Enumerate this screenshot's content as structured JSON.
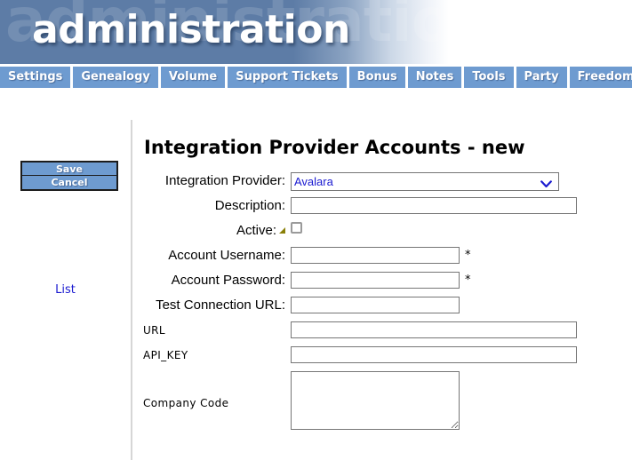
{
  "banner": {
    "title": "administration",
    "watermark": "administration"
  },
  "nav": {
    "items": [
      {
        "label": "Settings"
      },
      {
        "label": "Genealogy"
      },
      {
        "label": "Volume"
      },
      {
        "label": "Support Tickets"
      },
      {
        "label": "Bonus"
      },
      {
        "label": "Notes"
      },
      {
        "label": "Tools"
      },
      {
        "label": "Party"
      },
      {
        "label": "Freedom Bank"
      }
    ]
  },
  "sidebar": {
    "save_label": "Save",
    "cancel_label": "Cancel",
    "list_label": "List"
  },
  "main": {
    "page_title": "Integration Provider Accounts - new",
    "fields": {
      "integration_provider": {
        "label": "Integration Provider:",
        "value": "Avalara",
        "options": [
          "Avalara"
        ]
      },
      "description": {
        "label": "Description:",
        "value": "",
        "placeholder": ""
      },
      "active": {
        "label": "Active:",
        "checked": false,
        "help_icon": "help-triangle-icon"
      },
      "account_username": {
        "label": "Account Username:",
        "value": "",
        "placeholder": "",
        "required_marker": "*"
      },
      "account_password": {
        "label": "Account Password:",
        "value": "",
        "placeholder": "",
        "required_marker": "*"
      },
      "test_connection_url": {
        "label": "Test Connection URL:",
        "value": "",
        "placeholder": ""
      },
      "url": {
        "label": "URL",
        "value": "",
        "placeholder": ""
      },
      "api_key": {
        "label": "API_KEY",
        "value": "",
        "placeholder": ""
      },
      "company_code": {
        "label": "Company Code",
        "value": "",
        "placeholder": ""
      }
    }
  },
  "colors": {
    "nav_blue": "#6e9bd0",
    "banner_blue": "#5d7ca6",
    "link_blue": "#1a1ad0",
    "help_olive": "#8a8008"
  }
}
